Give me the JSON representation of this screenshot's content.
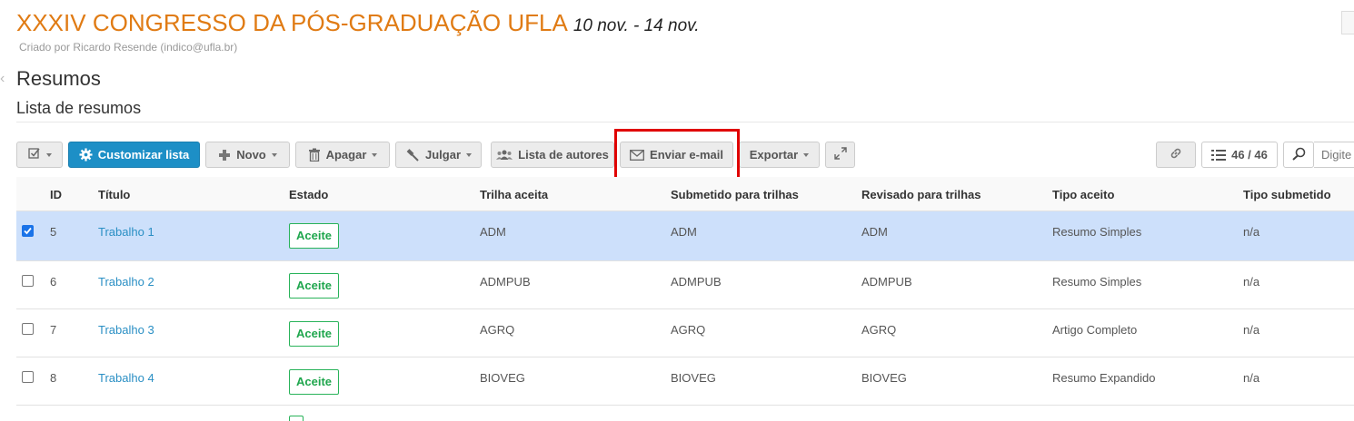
{
  "header": {
    "title": "XXXIV CONGRESSO DA PÓS-GRADUAÇÃO UFLA",
    "dates": "10 nov. - 14 nov.",
    "created_by": "Criado por Ricardo Resende (indico@ufla.br)"
  },
  "page": {
    "section_title": "Resumos",
    "subtitle": "Lista de resumos"
  },
  "toolbar": {
    "customize": "Customizar lista",
    "new": "Novo",
    "delete": "Apagar",
    "judge": "Julgar",
    "authors": "Lista de autores",
    "email": "Enviar e-mail",
    "export": "Exportar",
    "count": "46 / 46",
    "search_placeholder": "Digite"
  },
  "table": {
    "columns": [
      "ID",
      "Título",
      "Estado",
      "Trilha aceita",
      "Submetido para trilhas",
      "Revisado para trilhas",
      "Tipo aceito",
      "Tipo submetido"
    ],
    "rows": [
      {
        "id": "5",
        "title": "Trabalho 1",
        "state": "Aceite",
        "accepted_track": "ADM",
        "submitted_tracks": "ADM",
        "reviewed_tracks": "ADM",
        "accepted_type": "Resumo Simples",
        "submitted_type": "n/a",
        "selected": true
      },
      {
        "id": "6",
        "title": "Trabalho 2",
        "state": "Aceite",
        "accepted_track": "ADMPUB",
        "submitted_tracks": "ADMPUB",
        "reviewed_tracks": "ADMPUB",
        "accepted_type": "Resumo Simples",
        "submitted_type": "n/a",
        "selected": false
      },
      {
        "id": "7",
        "title": "Trabalho 3",
        "state": "Aceite",
        "accepted_track": "AGRQ",
        "submitted_tracks": "AGRQ",
        "reviewed_tracks": "AGRQ",
        "accepted_type": "Artigo Completo",
        "submitted_type": "n/a",
        "selected": false
      },
      {
        "id": "8",
        "title": "Trabalho 4",
        "state": "Aceite",
        "accepted_track": "BIOVEG",
        "submitted_tracks": "BIOVEG",
        "reviewed_tracks": "BIOVEG",
        "accepted_type": "Resumo Expandido",
        "submitted_type": "n/a",
        "selected": false
      }
    ]
  },
  "colors": {
    "accent": "#e07b14",
    "primary_button": "#1d8fc6",
    "selected_row": "#cde0fb",
    "accepted_badge": "#1fa64d",
    "highlight": "#e00000"
  }
}
